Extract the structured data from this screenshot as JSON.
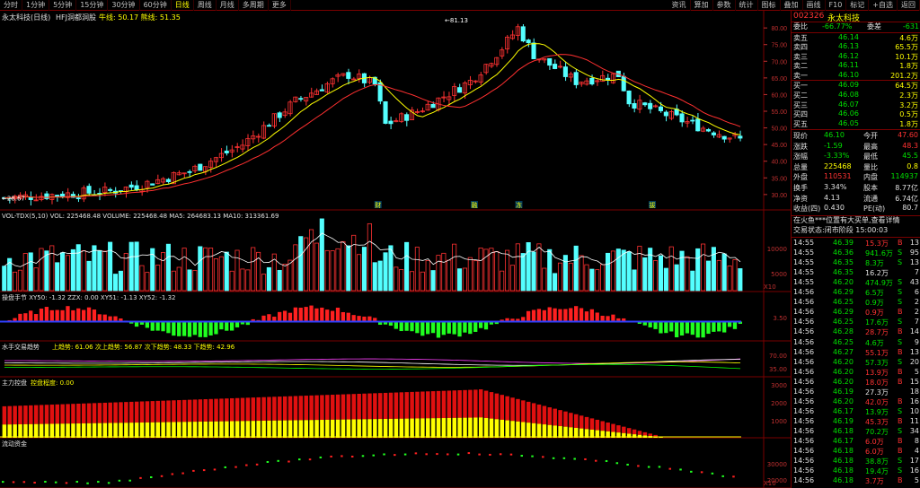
{
  "toolbar": {
    "timeframes": [
      "分时",
      "1分钟",
      "5分钟",
      "15分钟",
      "30分钟",
      "60分钟",
      "日线",
      "周线",
      "月线",
      "多周期",
      "更多"
    ],
    "active_timeframe": "日线",
    "right_buttons": [
      "叠加",
      "画线",
      "F10",
      "标记",
      "+自选",
      "返回"
    ],
    "right_menu": [
      "资讯",
      "算加",
      "参数",
      "统计",
      "图标"
    ]
  },
  "main_chart": {
    "title": "永太科技(日线)",
    "indicator": "HFJ洞都洞股",
    "indicator_values": "牛线: 50.17  熊线: 51.35",
    "peak_label": "81.13",
    "low_label": "28.67",
    "price_ticks": [
      "80.00",
      "75.00",
      "70.00",
      "65.00",
      "60.00",
      "55.00",
      "50.00",
      "45.00",
      "40.00",
      "35.00",
      "30.00"
    ],
    "signal_tags": [
      {
        "text": "财",
        "x_ratio": 0.51
      },
      {
        "text": "融",
        "x_ratio": 0.64
      },
      {
        "text": "冻",
        "x_ratio": 0.7
      },
      {
        "text": "拔",
        "x_ratio": 0.88
      }
    ]
  },
  "volume_panel": {
    "header": "VOL-TDX(5,10)  VOL: 225468.48  VOLUME: 225468.48  MA5: 264683.13  MA10: 313361.69",
    "ticks": [
      "10000",
      "5000"
    ],
    "unit": "X10"
  },
  "kdj_panel": {
    "header": "操盘手节  XY50: -1.32  ZZX: 0.00  XY51: -1.13  XY52: -1.32",
    "tick": "3.50"
  },
  "trend_panel": {
    "header": "水手交易趋势",
    "values": "上趋势: 61.06  次上趋势: 56.87  次下趋势: 48.33  下趋势: 42.96",
    "ticks": [
      "70.00",
      "35.00"
    ]
  },
  "capital_panel": {
    "header": "主力控盘",
    "value": "控盘程度: 0.00",
    "ticks": [
      "3000",
      "2000",
      "1000"
    ]
  },
  "flow_panel": {
    "header": "流动资金",
    "ticks": [
      "30000",
      "20000"
    ],
    "unit": "X10"
  },
  "quote": {
    "code": "002326",
    "name": "永太科技",
    "wei_bi_label": "委比",
    "wei_bi": "-66.77%",
    "wei_cha_label": "委差",
    "wei_cha": "-631",
    "asks": [
      {
        "label": "卖五",
        "price": "46.14",
        "vol": "4.6万"
      },
      {
        "label": "卖四",
        "price": "46.13",
        "vol": "65.5万"
      },
      {
        "label": "卖三",
        "price": "46.12",
        "vol": "10.1万"
      },
      {
        "label": "卖二",
        "price": "46.11",
        "vol": "1.8万"
      },
      {
        "label": "卖一",
        "price": "46.10",
        "vol": "201.2万"
      }
    ],
    "bids": [
      {
        "label": "买一",
        "price": "46.09",
        "vol": "64.5万"
      },
      {
        "label": "买二",
        "price": "46.08",
        "vol": "2.3万"
      },
      {
        "label": "买三",
        "price": "46.07",
        "vol": "3.2万"
      },
      {
        "label": "买四",
        "price": "46.06",
        "vol": "0.5万"
      },
      {
        "label": "买五",
        "price": "46.05",
        "vol": "1.8万"
      }
    ],
    "stats": [
      {
        "l1": "现价",
        "v1": "46.10",
        "l2": "今开",
        "v2": "47.60",
        "c1": "grn",
        "c2": "red"
      },
      {
        "l1": "涨跌",
        "v1": "-1.59",
        "l2": "最高",
        "v2": "48.3",
        "c1": "grn",
        "c2": "red"
      },
      {
        "l1": "涨幅",
        "v1": "-3.33%",
        "l2": "最低",
        "v2": "45.5",
        "c1": "grn",
        "c2": "grn"
      },
      {
        "l1": "总量",
        "v1": "225468",
        "l2": "量比",
        "v2": "0.8",
        "c1": "yel",
        "c2": "yel"
      },
      {
        "l1": "外盘",
        "v1": "110531",
        "l2": "内盘",
        "v2": "114937",
        "c1": "red",
        "c2": "grn"
      },
      {
        "l1": "换手",
        "v1": "3.34%",
        "l2": "股本",
        "v2": "8.77亿",
        "c1": "wht",
        "c2": "wht"
      },
      {
        "l1": "净资",
        "v1": "4.13",
        "l2": "流通",
        "v2": "6.74亿",
        "c1": "wht",
        "c2": "wht"
      },
      {
        "l1": "收益(四)",
        "v1": "0.430",
        "l2": "PE(动)",
        "v2": "80.7",
        "c1": "wht",
        "c2": "wht"
      }
    ],
    "notice1": "在火鱼***位置有大买单,查看详情",
    "notice2": "交易状态:闭市阶段 15:00:03",
    "ticks": [
      {
        "t": "14:55",
        "p": "46.39",
        "v": "15.3万",
        "s": "B",
        "n": "13"
      },
      {
        "t": "14:55",
        "p": "46.36",
        "v": "941.6万",
        "s": "S",
        "n": "95"
      },
      {
        "t": "14:55",
        "p": "46.35",
        "v": "8.3万",
        "s": "S",
        "n": "13"
      },
      {
        "t": "14:55",
        "p": "46.35",
        "v": "16.2万",
        "s": "",
        "n": "7"
      },
      {
        "t": "14:55",
        "p": "46.20",
        "v": "474.9万",
        "s": "S",
        "n": "43"
      },
      {
        "t": "14:56",
        "p": "46.29",
        "v": "6.5万",
        "s": "S",
        "n": "6"
      },
      {
        "t": "14:56",
        "p": "46.25",
        "v": "0.9万",
        "s": "S",
        "n": "2"
      },
      {
        "t": "14:56",
        "p": "46.29",
        "v": "0.9万",
        "s": "B",
        "n": "2"
      },
      {
        "t": "14:56",
        "p": "46.25",
        "v": "17.6万",
        "s": "S",
        "n": "7"
      },
      {
        "t": "14:56",
        "p": "46.28",
        "v": "28.7万",
        "s": "B",
        "n": "14"
      },
      {
        "t": "14:56",
        "p": "46.25",
        "v": "4.6万",
        "s": "S",
        "n": "9"
      },
      {
        "t": "14:56",
        "p": "46.27",
        "v": "55.1万",
        "s": "B",
        "n": "13"
      },
      {
        "t": "14:56",
        "p": "46.20",
        "v": "57.3万",
        "s": "S",
        "n": "20"
      },
      {
        "t": "14:56",
        "p": "46.20",
        "v": "13.9万",
        "s": "B",
        "n": "5"
      },
      {
        "t": "14:56",
        "p": "46.20",
        "v": "18.0万",
        "s": "B",
        "n": "15"
      },
      {
        "t": "14:56",
        "p": "46.19",
        "v": "27.3万",
        "s": "",
        "n": "18"
      },
      {
        "t": "14:56",
        "p": "46.20",
        "v": "42.0万",
        "s": "B",
        "n": "16"
      },
      {
        "t": "14:56",
        "p": "46.17",
        "v": "13.9万",
        "s": "S",
        "n": "10"
      },
      {
        "t": "14:56",
        "p": "46.19",
        "v": "45.3万",
        "s": "B",
        "n": "11"
      },
      {
        "t": "14:56",
        "p": "46.18",
        "v": "70.2万",
        "s": "S",
        "n": "34"
      },
      {
        "t": "14:56",
        "p": "46.17",
        "v": "6.0万",
        "s": "B",
        "n": "8"
      },
      {
        "t": "14:56",
        "p": "46.18",
        "v": "6.0万",
        "s": "B",
        "n": "4"
      },
      {
        "t": "14:56",
        "p": "46.18",
        "v": "38.8万",
        "s": "S",
        "n": "17"
      },
      {
        "t": "14:56",
        "p": "46.18",
        "v": "19.4万",
        "s": "S",
        "n": "16"
      },
      {
        "t": "14:56",
        "p": "46.18",
        "v": "3.7万",
        "s": "B",
        "n": "5"
      }
    ]
  },
  "colors": {
    "up": "#ff3232",
    "down": "#54ffff",
    "ma_white": "#ffffff",
    "ma_yellow": "#ffff00",
    "grid": "#7a0000"
  }
}
